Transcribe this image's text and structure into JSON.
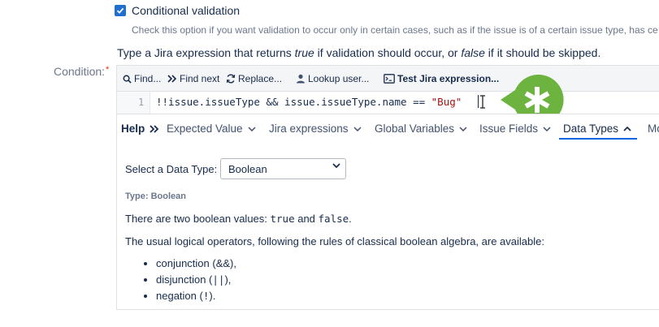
{
  "conditional_validation": {
    "checked": true,
    "label": "Conditional validation",
    "help": "Check this option if you want validation to occur only in certain cases, such as if the issue is of a certain issue type, has ce"
  },
  "instruction": {
    "prefix": "Type a Jira expression that returns ",
    "true_word": "true",
    "middle": " if validation should occur, or ",
    "false_word": "false",
    "suffix": " if it should be skipped."
  },
  "condition": {
    "label": "Condition:",
    "required_mark": "*"
  },
  "toolbar": {
    "find": "Find...",
    "find_next": "Find next",
    "replace": "Replace...",
    "lookup_user": "Lookup user...",
    "test_expression": "Test Jira expression..."
  },
  "editor": {
    "line_number": "1",
    "code_prefix": "!!issue.issueType && issue.issueType.name == ",
    "code_string": "\"Bug\""
  },
  "help_bar": {
    "title": "Help",
    "title_icon": "double-chevron-right-icon",
    "tabs": [
      {
        "label": "Expected Value",
        "active": false
      },
      {
        "label": "Jira expressions",
        "active": false
      },
      {
        "label": "Global Variables",
        "active": false
      },
      {
        "label": "Issue Fields",
        "active": false
      },
      {
        "label": "Data Types",
        "active": true
      },
      {
        "label": "Mo",
        "active": false
      }
    ]
  },
  "data_types": {
    "select_label": "Select a Data Type:",
    "selected_type": "Boolean",
    "type_heading": "Type: Boolean",
    "intro_prefix": "There are two boolean values: ",
    "value_true": "true",
    "intro_and": " and ",
    "value_false": "false",
    "intro_suffix": ".",
    "operators_text": "The usual logical operators, following the rules of classical boolean algebra, are available:",
    "operators": [
      {
        "name": "conjunction (&&),",
        "mono": false
      },
      {
        "prefix": "disjunction (",
        "symbol": "||",
        "suffix": "),"
      },
      {
        "prefix": "negation (",
        "symbol": "!",
        "suffix": ")."
      }
    ]
  },
  "colors": {
    "accent": "#1f6fd1",
    "callout_green": "#6db33f",
    "tab_underline": "#0c66e4"
  }
}
